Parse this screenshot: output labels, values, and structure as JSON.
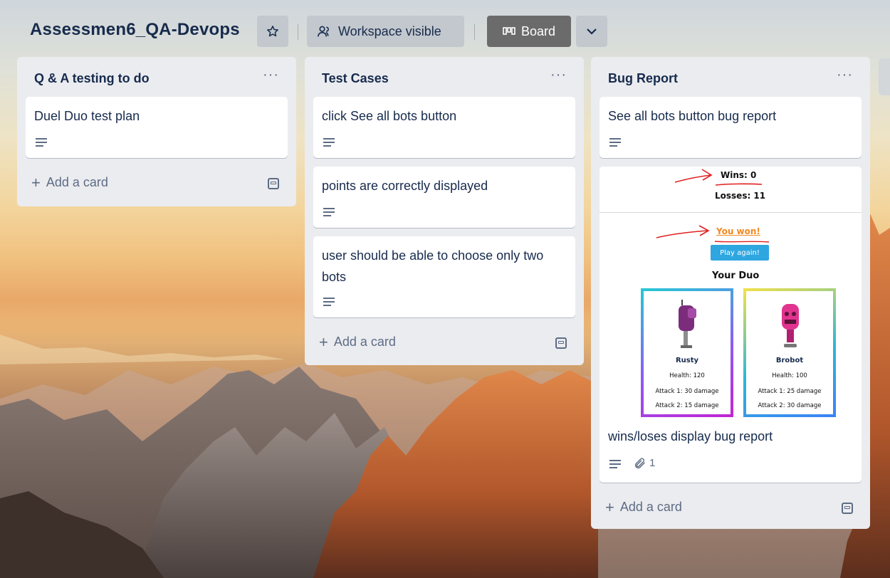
{
  "board": {
    "title": "Assessmen6_QA-Devops",
    "visibility_label": "Workspace visible",
    "view_label": "Board"
  },
  "icons": {
    "star": "star-icon",
    "visibility": "people-icon",
    "board_view": "board-view-icon",
    "chevron": "chevron-down-icon"
  },
  "colors": {
    "list_bg": "#ebecf0",
    "card_bg": "#ffffff",
    "board_button_bg": "#6b6b6b",
    "text": "#172b4d",
    "muted": "#5e6c84"
  },
  "lists": [
    {
      "title": "Q & A testing to do",
      "menu": "···",
      "cards": [
        {
          "title": "Duel Duo test plan"
        }
      ],
      "add_card": "Add a card"
    },
    {
      "title": "Test Cases",
      "menu": "···",
      "cards": [
        {
          "title": "click See all bots button"
        },
        {
          "title": "points are correctly displayed"
        },
        {
          "title": "user should be able to choose only two bots"
        }
      ],
      "add_card": "Add a card"
    },
    {
      "title": "Bug Report",
      "menu": "···",
      "cards": [
        {
          "title": "See all bots button bug report"
        },
        {
          "title": "wins/loses display bug report",
          "attachments": "1"
        }
      ],
      "add_card": "Add a card"
    }
  ],
  "cover": {
    "wins": "Wins: 0",
    "losses": "Losses: 11",
    "result": "You won!",
    "play_again": "Play again!",
    "duo_title": "Your Duo",
    "bots": [
      {
        "name": "Rusty",
        "health": "Health: 120",
        "attack1": "Attack 1: 30 damage",
        "attack2": "Attack 2: 15 damage"
      },
      {
        "name": "Brobot",
        "health": "Health: 100",
        "attack1": "Attack 1: 25 damage",
        "attack2": "Attack 2: 30 damage"
      }
    ]
  },
  "plus_glyph": "+"
}
